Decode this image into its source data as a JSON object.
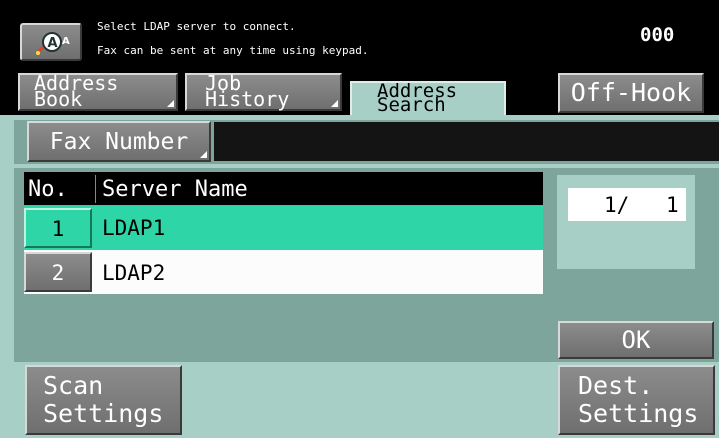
{
  "header": {
    "message_line1": "Select LDAP server to connect.",
    "message_line2": "Fax can be sent at any time using keypad.",
    "counter": "000",
    "icon": "help-person-icon"
  },
  "tabs": {
    "address_book": [
      "Address",
      "Book"
    ],
    "job_history": [
      "Job",
      "History"
    ],
    "address_search": [
      "Address",
      "Search"
    ],
    "off_hook": "Off-Hook"
  },
  "search": {
    "mode_label": "Fax Number",
    "value": ""
  },
  "table": {
    "col_no": "No.",
    "col_server": "Server Name",
    "rows": [
      {
        "no": "1",
        "name": "LDAP1",
        "selected": true
      },
      {
        "no": "2",
        "name": "LDAP2",
        "selected": false
      }
    ]
  },
  "pager": {
    "current": "1/",
    "total": "1"
  },
  "buttons": {
    "ok": "OK",
    "scan_settings": [
      "Scan",
      "Settings"
    ],
    "dest_settings": [
      "Dest.",
      "Settings"
    ]
  },
  "colors": {
    "teal_panel": "#a7cfc6",
    "selected_row": "#2ed6a7",
    "header_bg": "#000000"
  }
}
